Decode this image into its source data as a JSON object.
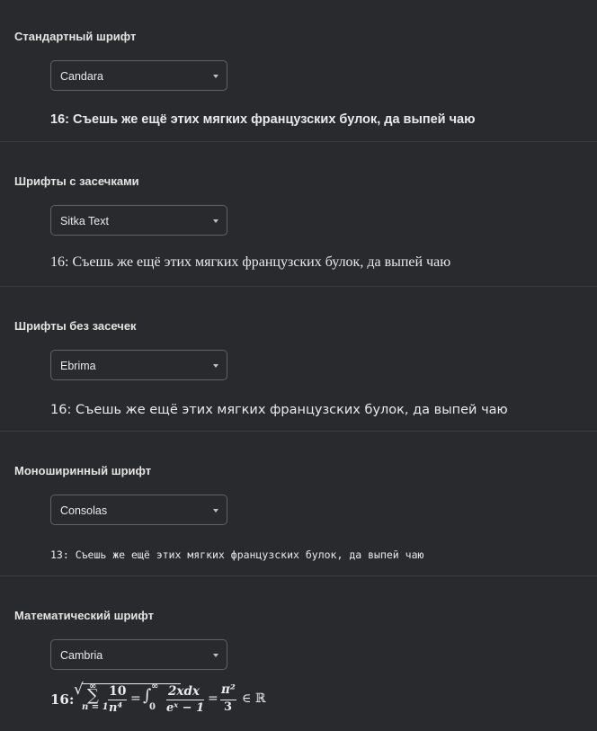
{
  "sections": [
    {
      "title": "Стандартный шрифт",
      "selected_font": "Candara",
      "sample": "16: Съешь же ещё этих мягких французских булок, да выпей чаю"
    },
    {
      "title": "Шрифты с засечками",
      "selected_font": "Sitka Text",
      "sample": "16: Съешь же ещё этих мягких французских булок, да выпей чаю"
    },
    {
      "title": "Шрифты без засечек",
      "selected_font": "Ebrima",
      "sample": "16: Съешь же ещё этих мягких французских булок, да выпей чаю"
    },
    {
      "title": "Моноширинный шрифт",
      "selected_font": "Consolas",
      "sample": "13: Съешь же ещё этих мягких французских булок, да выпей чаю"
    },
    {
      "title": "Математический шрифт",
      "selected_font": "Cambria",
      "math": {
        "prefix": "16:",
        "sqrt": "√",
        "sum_symbol": "∑",
        "sum_upper": "∞",
        "sum_lower": "n = 1",
        "frac1_num": "10",
        "frac1_den": "n⁴",
        "eq1": "=",
        "int_symbol": "∫",
        "int_upper": "∞",
        "int_lower": "0",
        "frac2_num": "2xdx",
        "frac2_den": "eˣ − 1",
        "eq2": "=",
        "frac3_num": "π²",
        "frac3_den": "3",
        "in_set": "∈ ℝ"
      }
    }
  ],
  "icons": {
    "dropdown": "chevron-down-icon"
  },
  "colors": {
    "background": "#292a2d",
    "text": "#e8eaed",
    "divider": "#3c3d40",
    "border": "#5f6368"
  }
}
